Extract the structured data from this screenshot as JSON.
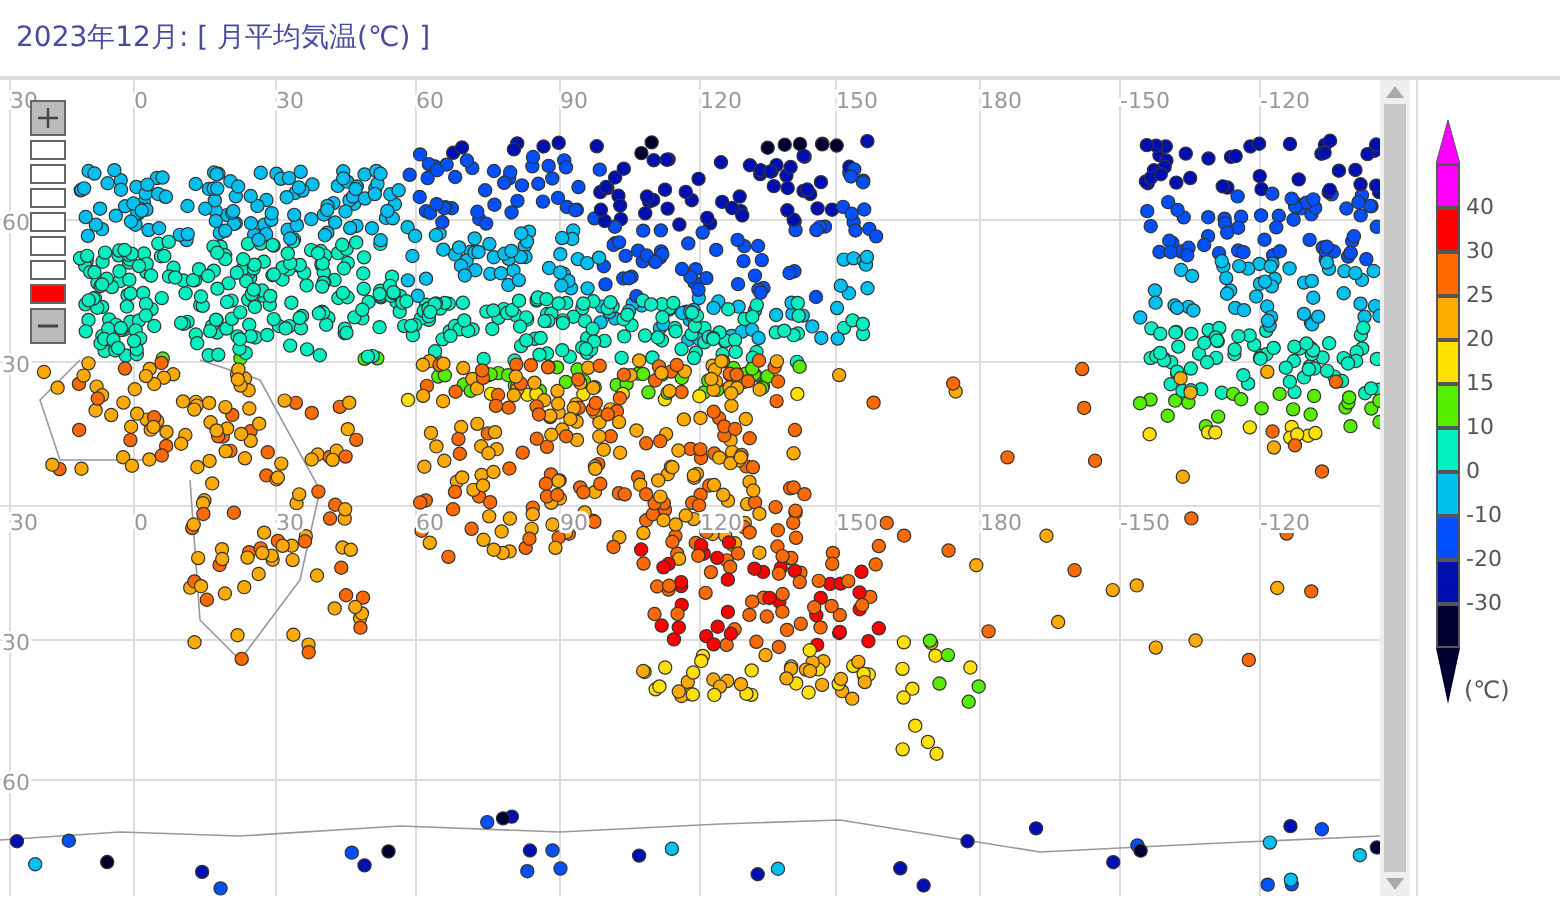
{
  "title": "2023年12月: [ 月平均気温(℃) ]",
  "map": {
    "lon_labels": [
      "30",
      "0",
      "30",
      "60",
      "90",
      "120",
      "150",
      "180",
      "-150",
      "-120"
    ],
    "lon_labels_equator": [
      "30",
      "0",
      "30",
      "60",
      "90",
      "120",
      "150",
      "180",
      "-150",
      "-120"
    ],
    "lat_labels": [
      "60",
      "30",
      "30",
      "60"
    ],
    "zoom": {
      "levels": [
        {
          "selected": false
        },
        {
          "selected": false
        },
        {
          "selected": false
        },
        {
          "selected": false
        },
        {
          "selected": false
        },
        {
          "selected": false
        },
        {
          "selected": true
        }
      ]
    }
  },
  "legend": {
    "segments": [
      {
        "color": "#ff00ff",
        "label": "40"
      },
      {
        "color": "#ff0000",
        "label": "30"
      },
      {
        "color": "#ff6a00",
        "label": "25"
      },
      {
        "color": "#ffaa00",
        "label": "20"
      },
      {
        "color": "#ffe000",
        "label": "15"
      },
      {
        "color": "#55ee00",
        "label": "10"
      },
      {
        "color": "#00f0c0",
        "label": "0"
      },
      {
        "color": "#00c0f0",
        "label": "-10"
      },
      {
        "color": "#0050ff",
        "label": "-20"
      },
      {
        "color": "#0010b0",
        "label": "-30"
      },
      {
        "color": "#000030"
      }
    ],
    "unit": "(℃)"
  }
}
